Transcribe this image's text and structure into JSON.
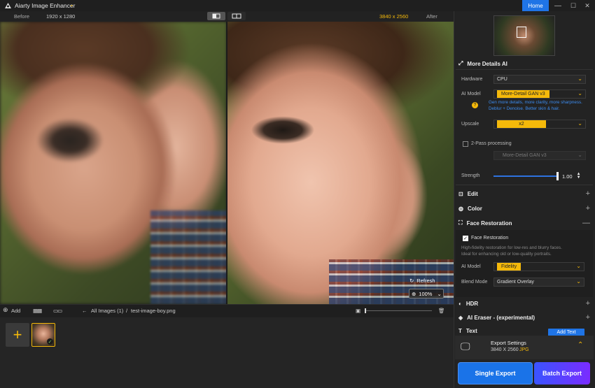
{
  "titlebar": {
    "app_title": "Aiarty Image Enhancer",
    "home_label": "Home",
    "controls": [
      "—",
      "☐",
      "✕"
    ]
  },
  "compare": {
    "before_label": "Before",
    "before_size": "1920 x 1280",
    "after_size": "3840 x 2560",
    "after_label": "After",
    "accent_color": "#f5b90a"
  },
  "viewer": {
    "refresh_label": "Refresh",
    "zoom_value": "100%"
  },
  "bottombar": {
    "add_label": "Add",
    "all_images_label": "All Images (1)",
    "separator": "/",
    "file_name": "test-image-boy.png"
  },
  "panel": {
    "model_section_title": "More Details AI",
    "hardware_label": "Hardware",
    "hardware_value": "CPU",
    "ai_model_label": "AI Model",
    "ai_model_value": "More-Detail GAN  v3",
    "ai_model_help_line1": "Gen more details, more clarity, more sharpness.",
    "ai_model_help_line2": "Deblur + Denoise. Better skin & hair.",
    "upscale_label": "Upscale",
    "upscale_value": "x2",
    "two_pass_label": "2-Pass processing",
    "two_pass_model": "More-Detail GAN  v3",
    "strength_label": "Strength",
    "strength_value": "1.00",
    "edit_label": "Edit",
    "color_label": "Color",
    "face_restoration_label": "Face Restoration",
    "face_restoration_checkbox": "Face Restoration",
    "face_help_line1": "High-fidelity restoration for low-res and blurry faces.",
    "face_help_line2": "Ideal for enhancing old or low-quality portraits.",
    "face_ai_model_label": "AI Model",
    "face_ai_model_value": "Fidelity",
    "blend_mode_label": "Blend Mode",
    "blend_mode_value": "Gradient Overlay",
    "hdr_label": "HDR",
    "ai_eraser_label": "AI Eraser - (experimental)",
    "text_label": "Text",
    "add_text_label": "Add Text",
    "export_settings_label": "Export Settings",
    "export_size": "3840 X 2560",
    "export_format": "JPG",
    "single_export_label": "Single Export",
    "batch_export_label": "Batch Export"
  }
}
